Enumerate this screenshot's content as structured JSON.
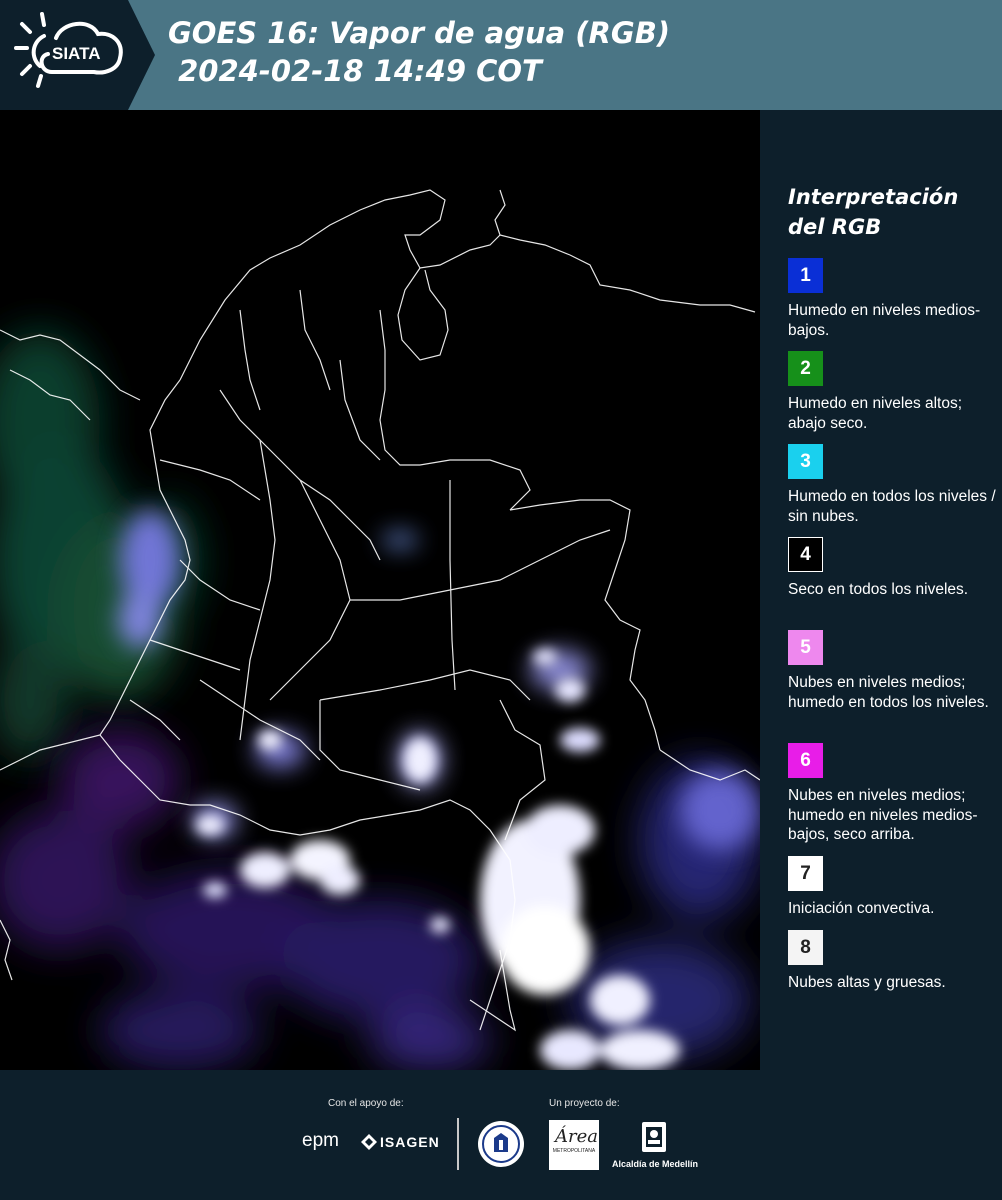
{
  "header": {
    "logo_text": "SIATA",
    "title_line1": "GOES 16: Vapor de agua (RGB)",
    "title_line2": " 2024-02-18 14:49 COT",
    "bg_color": "#4a7585"
  },
  "map": {
    "description_icon": "satellite-map",
    "border_color": "#ffffff",
    "background": "#000000"
  },
  "legend": {
    "title": "Interpretación del RGB",
    "items": [
      {
        "num": "1",
        "color": "#0a2fd6",
        "num_color": "#ffffff",
        "text": "Humedo en niveles medios-bajos."
      },
      {
        "num": "2",
        "color": "#16901a",
        "num_color": "#ffffff",
        "text": "Humedo en niveles altos; abajo seco."
      },
      {
        "num": "3",
        "color": "#1ad0ee",
        "num_color": "#ffffff",
        "text": "Humedo en todos los niveles / sin nubes."
      },
      {
        "num": "4",
        "color": "#000000",
        "num_color": "#ffffff",
        "text": "Seco en todos los niveles."
      },
      {
        "num": "5",
        "color": "#ee88ee",
        "num_color": "#ffffff",
        "text": "Nubes en niveles medios; humedo en todos los niveles."
      },
      {
        "num": "6",
        "color": "#e81de8",
        "num_color": "#ffffff",
        "text": "Nubes en niveles medios; humedo en niveles medios-bajos, seco arriba."
      },
      {
        "num": "7",
        "color": "#ffffff",
        "num_color": "#222222",
        "text": "Iniciación convectiva."
      },
      {
        "num": "8",
        "color": "#f4f4f4",
        "num_color": "#222222",
        "text": "Nubes altas y gruesas."
      }
    ]
  },
  "footer": {
    "support_label": "Con el apoyo de:",
    "project_label": "Un proyecto de:",
    "epm": "epm",
    "isagen": "ISAGEN",
    "area_script": "Área",
    "area_text": "METROPOLITANA",
    "alcaldia": "Alcaldía de Medellín"
  }
}
